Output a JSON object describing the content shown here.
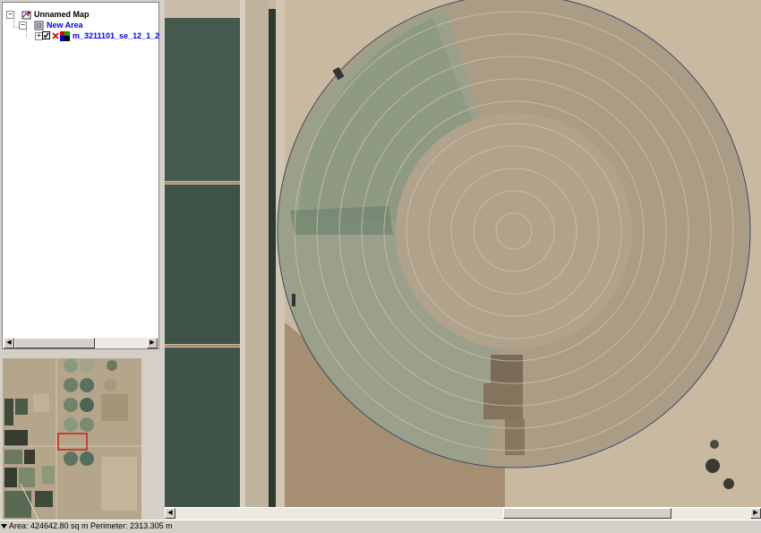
{
  "toc": {
    "map_name": "Unnamed Map",
    "area_name": "New Area",
    "layer_name": "m_3211101_se_12_1_2"
  },
  "status": {
    "text": "Area: 424642.80 sq m Perimeter: 2313.305 m"
  },
  "colors": {
    "selection_box": "#cc0000",
    "polygon_outline": "#3a4a6a"
  }
}
